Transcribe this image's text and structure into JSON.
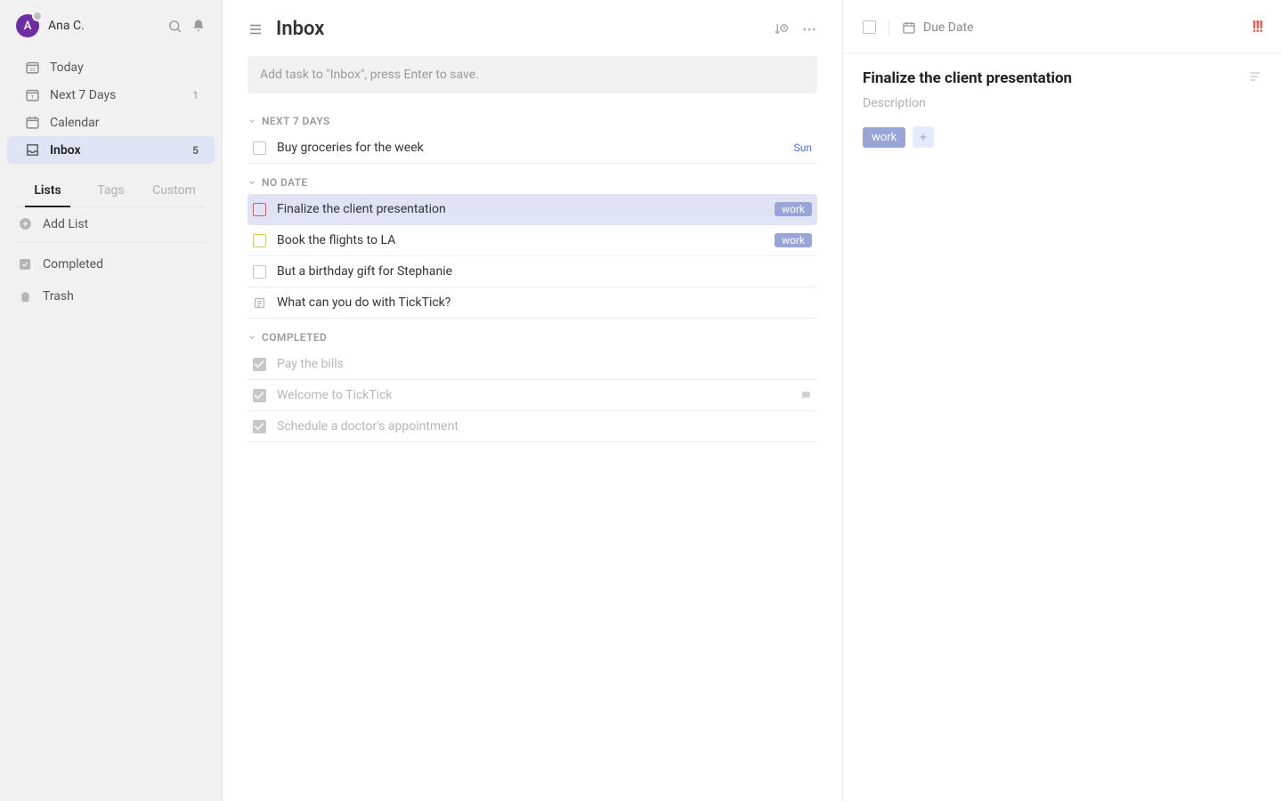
{
  "user": {
    "initial": "A",
    "name": "Ana C."
  },
  "sidebar": {
    "nav": [
      {
        "label": "Today",
        "count": ""
      },
      {
        "label": "Next 7 Days",
        "count": "1"
      },
      {
        "label": "Calendar",
        "count": ""
      },
      {
        "label": "Inbox",
        "count": "5"
      }
    ],
    "tabs": [
      "Lists",
      "Tags",
      "Custom"
    ],
    "add_list": "Add List",
    "completed": "Completed",
    "trash": "Trash"
  },
  "main": {
    "title": "Inbox",
    "add_placeholder": "Add task to \"Inbox\", press Enter to save.",
    "sections": {
      "next7": {
        "label": "NEXT 7 DAYS"
      },
      "nodate": {
        "label": "NO DATE"
      },
      "completed": {
        "label": "COMPLETED"
      }
    },
    "tasks_next7": [
      {
        "title": "Buy groceries for the week",
        "meta": "Sun"
      }
    ],
    "tasks_nodate": [
      {
        "title": "Finalize the client presentation",
        "tag": "work"
      },
      {
        "title": "Book the flights to LA",
        "tag": "work"
      },
      {
        "title": "But a birthday gift for Stephanie"
      },
      {
        "title": "What can you do with TickTick?"
      }
    ],
    "tasks_completed": [
      {
        "title": "Pay the bills"
      },
      {
        "title": "Welcome to TickTick"
      },
      {
        "title": "Schedule a doctor's appointment"
      }
    ]
  },
  "detail": {
    "due_date_label": "Due Date",
    "priority_glyph": "!!!",
    "title": "Finalize the client presentation",
    "description_placeholder": "Description",
    "tag": "work"
  }
}
